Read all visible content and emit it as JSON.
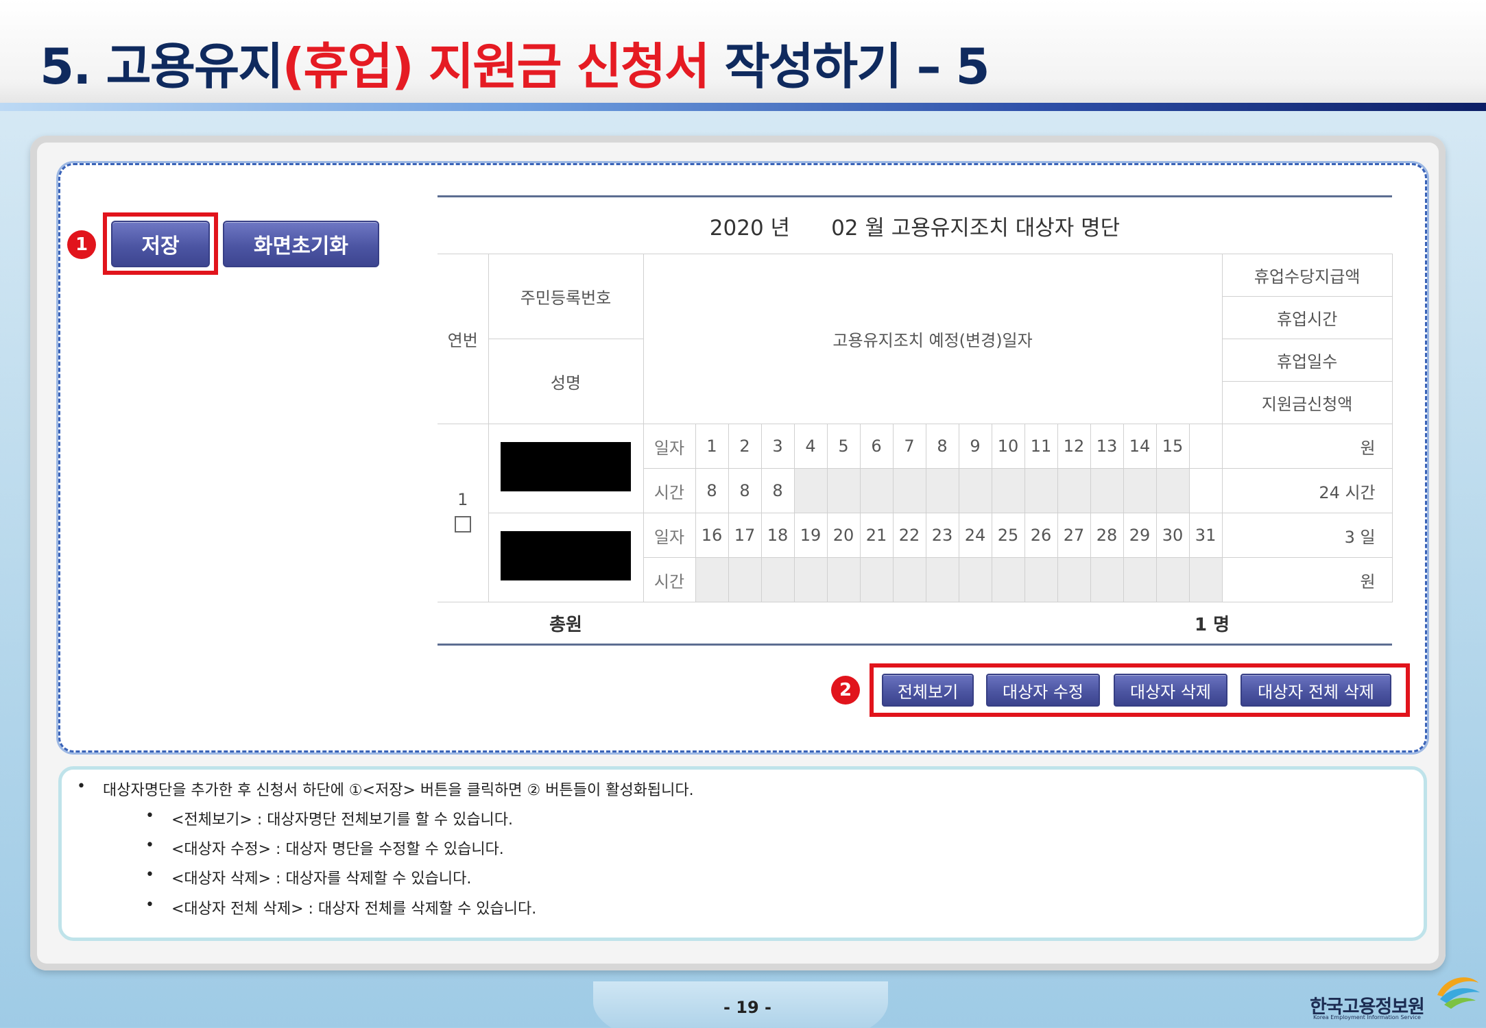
{
  "header": {
    "title_part1": "5. 고용유지",
    "title_part2": "(휴업) 지원금 신청서",
    "title_part3": " 작성하기 – 5"
  },
  "buttons": {
    "save": "저장",
    "reset": "화면초기화",
    "view_all": "전체보기",
    "edit_target": "대상자 수정",
    "delete_target": "대상자 삭제",
    "delete_all": "대상자 전체 삭제"
  },
  "badges": {
    "one": "1",
    "two": "2"
  },
  "table": {
    "caption_year": "2020 년",
    "caption_rest": "02 월 고용유지조치 대상자 명단",
    "col_seq": "연번",
    "col_rrn": "주민등록번호",
    "col_name": "성명",
    "col_dates": "고용유지조치 예정(변경)일자",
    "col_allowance": "휴업수당지급액",
    "col_hours": "휴업시간",
    "col_days": "휴업일수",
    "col_amount": "지원금신청액",
    "row_seq": "1",
    "label_day": "일자",
    "label_time": "시간",
    "days1": [
      "1",
      "2",
      "3",
      "4",
      "5",
      "6",
      "7",
      "8",
      "9",
      "10",
      "11",
      "12",
      "13",
      "14",
      "15",
      ""
    ],
    "hours1": [
      "8",
      "8",
      "8",
      "",
      "",
      "",
      "",
      "",
      "",
      "",
      "",
      "",
      "",
      "",
      "",
      ""
    ],
    "days2": [
      "16",
      "17",
      "18",
      "19",
      "20",
      "21",
      "22",
      "23",
      "24",
      "25",
      "26",
      "27",
      "28",
      "29",
      "30",
      "31"
    ],
    "hours2": [
      "",
      "",
      "",
      "",
      "",
      "",
      "",
      "",
      "",
      "",
      "",
      "",
      "",
      "",
      "",
      ""
    ],
    "allowance_value": "원",
    "hours_value": "24 시간",
    "days_value": "3 일",
    "amount_value": "원",
    "total_label": "총원",
    "total_value": "1 명"
  },
  "notes": {
    "main": "대상자명단을 추가한 후 신청서 하단에 ①<저장> 버튼을 클릭하면 ② 버튼들이 활성화됩니다.",
    "items": [
      "<전체보기> : 대상자명단 전체보기를 할 수 있습니다.",
      "<대상자 수정> : 대상자 명단을 수정할 수 있습니다.",
      "<대상자 삭제> : 대상자를 삭제할 수 있습니다.",
      "<대상자 전체 삭제> : 대상자 전체를 삭제할 수 있습니다."
    ],
    "bullet": "•"
  },
  "footer": {
    "page": "- 19 -",
    "logo_name": "한국고용정보원",
    "logo_sub": "Korea Employment Information Service"
  }
}
